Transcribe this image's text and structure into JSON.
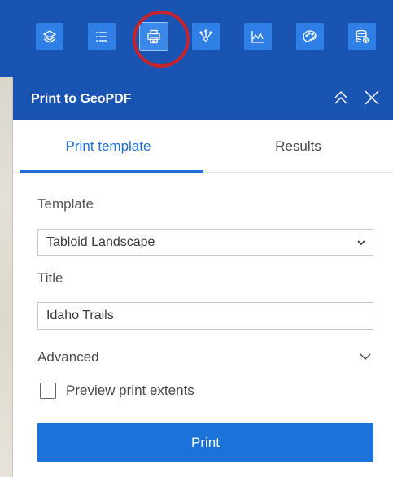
{
  "toolbar": {
    "tools": [
      {
        "icon": "layers-icon"
      },
      {
        "icon": "list-icon"
      },
      {
        "icon": "printer-icon"
      },
      {
        "icon": "network-icon"
      },
      {
        "icon": "chart-icon"
      },
      {
        "icon": "palette-icon"
      },
      {
        "icon": "database-add-icon"
      }
    ],
    "active_tool": "printer-icon"
  },
  "panel": {
    "title": "Print to GeoPDF",
    "tabs": [
      {
        "label": "Print template"
      },
      {
        "label": "Results"
      }
    ],
    "active_tab": "Print template",
    "template_label": "Template",
    "template_value": "Tabloid Landscape",
    "title_label": "Title",
    "title_value": "Idaho Trails",
    "advanced_label": "Advanced",
    "preview_label": "Preview print extents",
    "preview_checked": false,
    "print_button": "Print"
  },
  "colors": {
    "header_blue": "#1a54b3",
    "button_blue": "#2f7fe6",
    "accent_blue": "#1e70d6",
    "highlight_red": "#c8232c"
  }
}
